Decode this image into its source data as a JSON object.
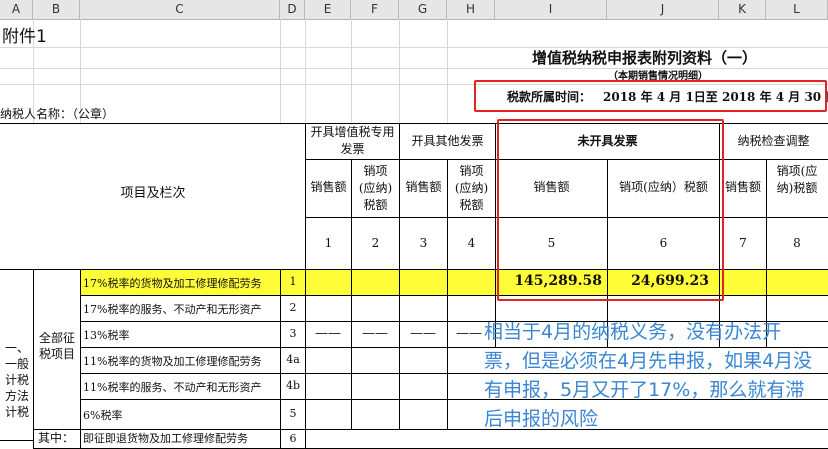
{
  "columns": [
    "A",
    "B",
    "C",
    "D",
    "E",
    "F",
    "G",
    "H",
    "I",
    "J",
    "K",
    "L"
  ],
  "sheet": {
    "attachment_label": "附件1",
    "title": "增值税纳税申报表附列资料（一）",
    "subtitle": "（本期销售情况明细）",
    "period_label": "税款所属时间：",
    "period_value": "2018 年 4 月 1日至  2018 年 4 月 30 日",
    "taxpayer_label": "纳税人名称：（公章）"
  },
  "header": {
    "item_col": "项目及栏次",
    "groups": [
      {
        "label": "开具增值税专用发票"
      },
      {
        "label": "开具其他发票"
      },
      {
        "label": "未开具发票"
      },
      {
        "label": "纳税检查调整"
      }
    ],
    "sub": {
      "sales": "销售额",
      "tax": "销项(应纳)税额",
      "tax_wide": "销项(应纳）税额"
    },
    "col_nums": [
      "1",
      "2",
      "3",
      "4",
      "5",
      "6",
      "7",
      "8"
    ]
  },
  "rows": [
    {
      "label": "17%税率的货物及加工修理修配劳务",
      "num": "1",
      "col5": "145,289.58",
      "col6": "24,699.23"
    },
    {
      "label": "17%税率的服务、不动产和无形资产",
      "num": "2"
    },
    {
      "label": "13%税率",
      "num": "3",
      "dash": "——"
    },
    {
      "label": "11%税率的货物及加工修理修配劳务",
      "num": "4a"
    },
    {
      "label": "11%税率的服务、不动产和无形资产",
      "num": "4b"
    },
    {
      "label": "6%税率",
      "num": "5"
    },
    {
      "label": "即征即退货物及加工修理修配劳务",
      "num": "6"
    }
  ],
  "section": {
    "left_label": "一、一般计税方法计税",
    "group_label": "全部征税项目",
    "partial_label": "其中："
  },
  "annotation": "相当于4月的纳税义务，没有办法开票，但是必须在4月先申报，如果4月没有申报，5月又开了17%，那么就有滞后申报的风险",
  "colors": {
    "highlight": "#fffd38",
    "callout": "#e02424",
    "note_text": "#3a86d4"
  }
}
